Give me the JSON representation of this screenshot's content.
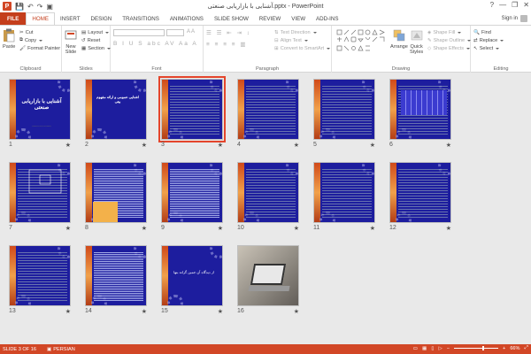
{
  "window": {
    "title": "آشنایی با بازاریابی صنعتی.pptx - PowerPoint",
    "app_icon_letter": "P",
    "controls": [
      "?",
      "—",
      "❐",
      "✕"
    ]
  },
  "qat": [
    "💾",
    "↶",
    "↷",
    "▣"
  ],
  "tabs": [
    {
      "label": "FILE"
    },
    {
      "label": "HOME"
    },
    {
      "label": "INSERT"
    },
    {
      "label": "DESIGN"
    },
    {
      "label": "TRANSITIONS"
    },
    {
      "label": "ANIMATIONS"
    },
    {
      "label": "SLIDE SHOW"
    },
    {
      "label": "REVIEW"
    },
    {
      "label": "VIEW"
    },
    {
      "label": "ADD-INS"
    }
  ],
  "signin": "Sign in",
  "ribbon": {
    "clipboard": {
      "label": "Clipboard",
      "paste": "Paste",
      "cut": "Cut",
      "copy": "Copy",
      "format_painter": "Format Painter"
    },
    "slides": {
      "label": "Slides",
      "new_slide": "New",
      "new_slide2": "Slide",
      "layout": "Layout",
      "reset": "Reset",
      "section": "Section"
    },
    "font": {
      "label": "Font"
    },
    "paragraph": {
      "label": "Paragraph",
      "text_direction": "Text Direction",
      "align_text": "Align Text",
      "smartart": "Convert to SmartArt"
    },
    "drawing": {
      "label": "Drawing",
      "arrange": "Arrange",
      "quick_styles": "Quick",
      "quick_styles2": "Styles",
      "shape_fill": "Shape Fill",
      "shape_outline": "Shape Outline",
      "shape_effects": "Shape Effects"
    },
    "editing": {
      "label": "Editing",
      "find": "Find",
      "replace": "Replace",
      "select": "Select"
    }
  },
  "slides": [
    {
      "num": "1",
      "kind": "title",
      "title": "آشنایی با بازاریابی صنعتی",
      "subtitle": "......... ..... .........."
    },
    {
      "num": "2",
      "kind": "title2",
      "title": "اشنایی عمومی و ارائه مفهوم بیتی"
    },
    {
      "num": "3",
      "kind": "text",
      "selected": true
    },
    {
      "num": "4",
      "kind": "text"
    },
    {
      "num": "5",
      "kind": "text"
    },
    {
      "num": "6",
      "kind": "table"
    },
    {
      "num": "7",
      "kind": "diagram"
    },
    {
      "num": "8",
      "kind": "orange"
    },
    {
      "num": "9",
      "kind": "dense"
    },
    {
      "num": "10",
      "kind": "text"
    },
    {
      "num": "11",
      "kind": "text"
    },
    {
      "num": "12",
      "kind": "text"
    },
    {
      "num": "13",
      "kind": "text"
    },
    {
      "num": "14",
      "kind": "dense"
    },
    {
      "num": "15",
      "kind": "closing",
      "title": "از دیدگاه آن جمین گرانه بنها"
    },
    {
      "num": "16",
      "kind": "photo"
    }
  ],
  "slide_marker": "★",
  "status": {
    "slide_info": "SLIDE 3 OF 16",
    "language": "PERSIAN",
    "zoom": "66%",
    "zoom_fraction": 0.66
  }
}
